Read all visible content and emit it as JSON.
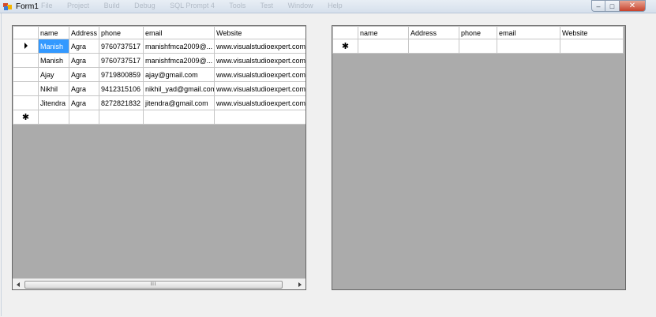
{
  "window": {
    "title": "Form1",
    "ghost_menu": [
      "File",
      "Project",
      "Build",
      "Debug",
      "SQL Prompt 4",
      "Tools",
      "Test",
      "Window",
      "Help"
    ],
    "minimize_glyph": "–",
    "maximize_glyph": "□",
    "close_glyph": "✕"
  },
  "grid1": {
    "columns": [
      "name",
      "Address",
      "phone",
      "email",
      "Website"
    ],
    "rows": [
      [
        "Manish",
        "Agra",
        "9760737517",
        "manishfmca2009@...",
        "www.visualstudioexpert.com"
      ],
      [
        "Manish",
        "Agra",
        "9760737517",
        "manishfmca2009@...",
        "www.visualstudioexpert.com"
      ],
      [
        "Ajay",
        "Agra",
        "9719800859",
        "ajay@gmail.com",
        "www.visualstudioexpert.com"
      ],
      [
        "Nikhil",
        "Agra",
        "9412315106",
        "nikhil_yad@gmail.com",
        "www.visualstudioexpert.com"
      ],
      [
        "Jitendra",
        "Agra",
        "8272821832",
        "jitendra@gmail.com",
        "www.visualstudioexpert.com"
      ]
    ],
    "current_row_glyph": "▶",
    "new_row_glyph": "✱",
    "scroll_grip": "III"
  },
  "grid2": {
    "columns": [
      "name",
      "Address",
      "phone",
      "email",
      "Website"
    ],
    "new_row_glyph": "✱"
  },
  "colors": {
    "selection": "#3399ff",
    "grid_background": "#ababab",
    "form_background": "#f0f0f0"
  }
}
